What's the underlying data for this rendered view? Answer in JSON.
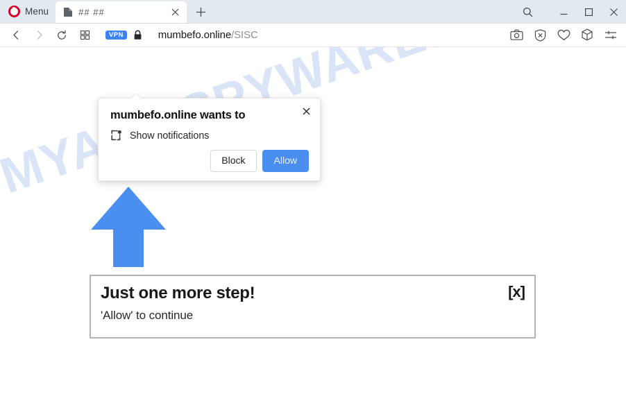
{
  "browser": {
    "name": "Opera",
    "menu_label": "Menu",
    "logo_color": "#d6002b",
    "titlebar_color": "#e3e9f1",
    "tab": {
      "title": "## ##",
      "favicon": "document-icon",
      "close_label": "×"
    },
    "new_tab_label": "+",
    "window_controls": [
      {
        "name": "search-icon",
        "label": "⌕"
      },
      {
        "name": "minimize-icon",
        "label": "—"
      },
      {
        "name": "maximize-icon",
        "label": "□"
      },
      {
        "name": "close-icon",
        "label": "×"
      }
    ],
    "nav": {
      "back": "back-arrow-icon",
      "forward": "forward-arrow-icon",
      "reload": "reload-icon",
      "speed_dial": "grid-squares-icon",
      "right_icons": [
        "snapshot-camera-icon",
        "ad-blocker-shield-icon",
        "heart-favorites-icon",
        "cube-extensions-icon",
        "easy-setup-sliders-icon"
      ]
    },
    "address_bar": {
      "vpn_badge": "VPN",
      "vpn_badge_color": "#3b82f6",
      "lock_icon": "padlock-icon",
      "url_host": "mumbefo.online",
      "url_path": "/SISC"
    }
  },
  "permission_popup": {
    "title": "mumbefo.online wants to",
    "permission_icon": "notification-bell-icon",
    "permission_text": "Show notifications",
    "close_label": "✕",
    "block_label": "Block",
    "allow_label": "Allow",
    "allow_color": "#4a8ef0"
  },
  "page": {
    "watermark": "MYANTISPYWARE.COM",
    "watermark_color": "#d9e4f7",
    "arrow": {
      "name": "blue-up-arrow",
      "color": "#4a8ef0"
    },
    "notice": {
      "title": "Just one more step!",
      "subtitle": "'Allow' to continue",
      "close_label": "[x]",
      "border_color": "#b3b3b3"
    }
  }
}
